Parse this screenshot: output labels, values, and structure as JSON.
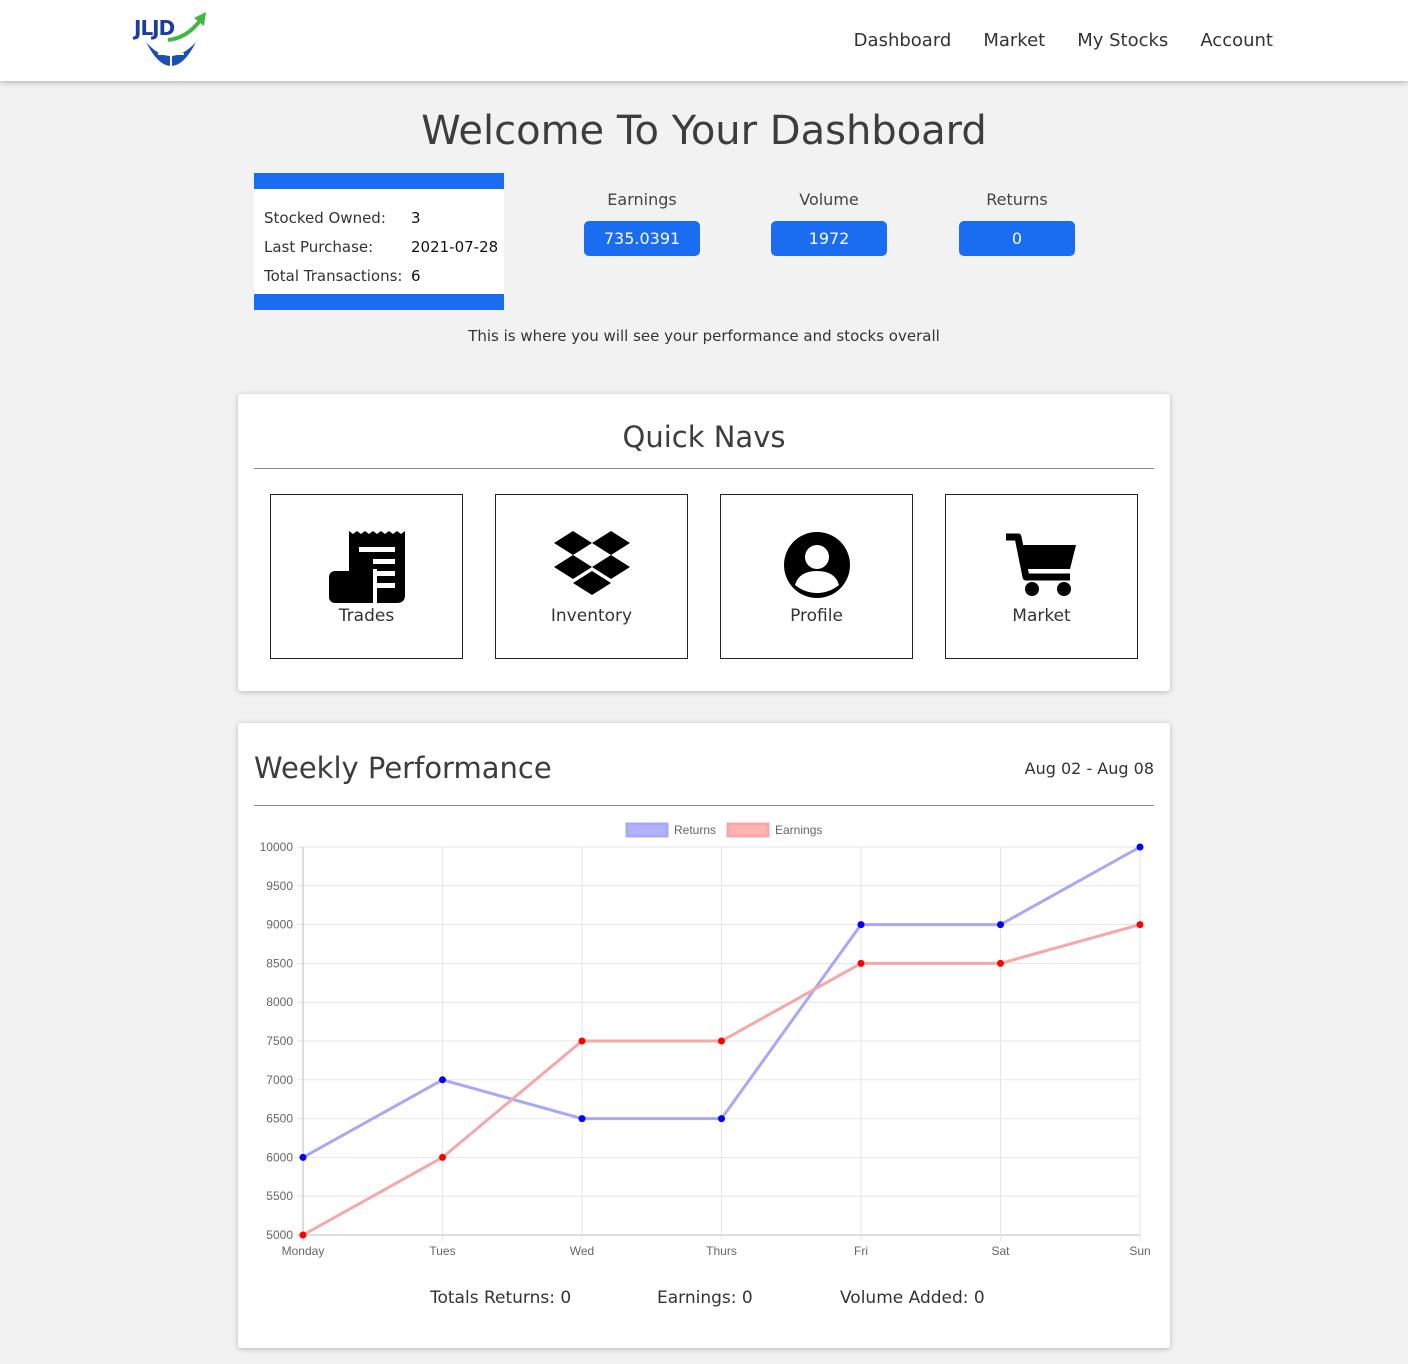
{
  "brand": {
    "logo_text": "JLJD"
  },
  "nav": {
    "items": [
      "Dashboard",
      "Market",
      "My Stocks",
      "Account"
    ]
  },
  "page_title": "Welcome To Your Dashboard",
  "summary": {
    "stocked_owned_label": "Stocked Owned:",
    "stocked_owned_value": "3",
    "last_purchase_label": "Last Purchase:",
    "last_purchase_value": "2021-07-28",
    "total_transactions_label": "Total Transactions:",
    "total_transactions_value": "6"
  },
  "metrics": {
    "earnings_label": "Earnings",
    "earnings_value": "735.0391",
    "volume_label": "Volume",
    "volume_value": "1972",
    "returns_label": "Returns",
    "returns_value": "0"
  },
  "subtitle": "This is where you will see your performance and stocks overall",
  "quick_navs": {
    "title": "Quick Navs",
    "items": [
      {
        "label": "Trades",
        "icon": "receipt-icon"
      },
      {
        "label": "Inventory",
        "icon": "dropbox-icon"
      },
      {
        "label": "Profile",
        "icon": "user-circle-icon"
      },
      {
        "label": "Market",
        "icon": "shopping-cart-icon"
      }
    ]
  },
  "performance": {
    "title": "Weekly Performance",
    "range": "Aug 02 - Aug 08",
    "totals_returns": "Totals Returns: 0",
    "totals_earnings": "Earnings: 0",
    "totals_volume": "Volume Added: 0"
  },
  "colors": {
    "accent": "#1a6cf0",
    "returns_line": "#a8a8f5",
    "returns_point": "#0000ff",
    "earnings_line": "#f5a8a8",
    "earnings_point": "#ff0000"
  },
  "chart_data": {
    "type": "line",
    "categories": [
      "Monday",
      "Tues",
      "Wed",
      "Thurs",
      "Fri",
      "Sat",
      "Sun"
    ],
    "series": [
      {
        "name": "Returns",
        "values": [
          6000,
          7000,
          6500,
          6500,
          9000,
          9000,
          10000
        ]
      },
      {
        "name": "Earnings",
        "values": [
          5000,
          6000,
          7500,
          7500,
          8500,
          8500,
          9000
        ]
      }
    ],
    "yticks": [
      5000,
      5500,
      6000,
      6500,
      7000,
      7500,
      8000,
      8500,
      9000,
      9500,
      10000
    ],
    "ylim": [
      5000,
      10000
    ],
    "grid": true,
    "legend_position": "top"
  }
}
